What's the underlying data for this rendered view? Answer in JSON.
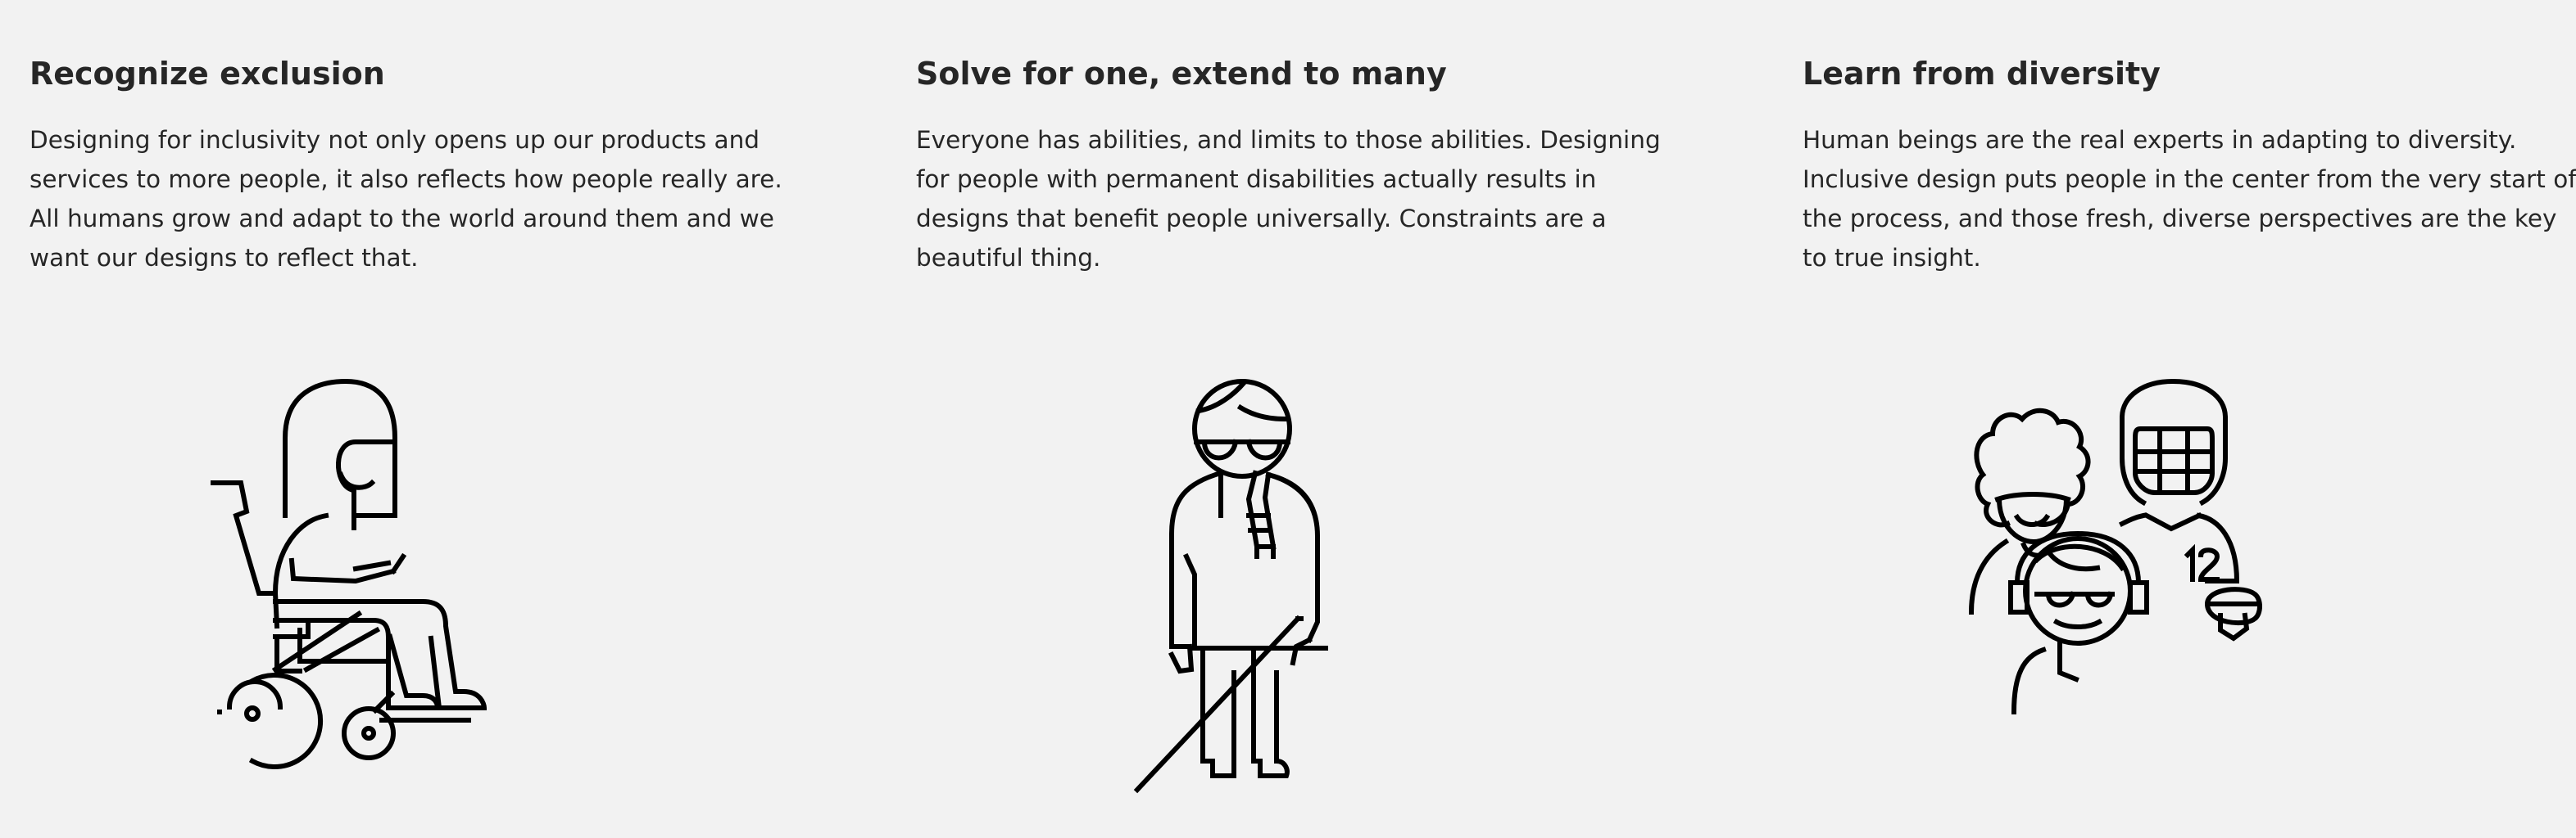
{
  "sections": [
    {
      "heading": "Recognize exclusion",
      "body": "Designing for inclusivity not only opens up our products and services to more people, it also reflects how people really are. All humans grow and adapt to the world around them and we want our designs to reflect that.",
      "illustration": "person-in-wheelchair"
    },
    {
      "heading": "Solve for one, extend to many",
      "body": "Everyone has abilities, and limits to those abilities. Designing for people with permanent disabilities actually results in designs that benefit people universally. Constraints are a beautiful thing.",
      "illustration": "person-with-white-cane"
    },
    {
      "heading": "Learn from diversity",
      "body": "Human beings are the real experts in adapting to diversity. Inclusive design puts people in the center from the very start of the process, and those fresh, diverse perspectives are the key to true insight.",
      "illustration": "diverse-group-of-people",
      "jersey_number": "12"
    }
  ]
}
